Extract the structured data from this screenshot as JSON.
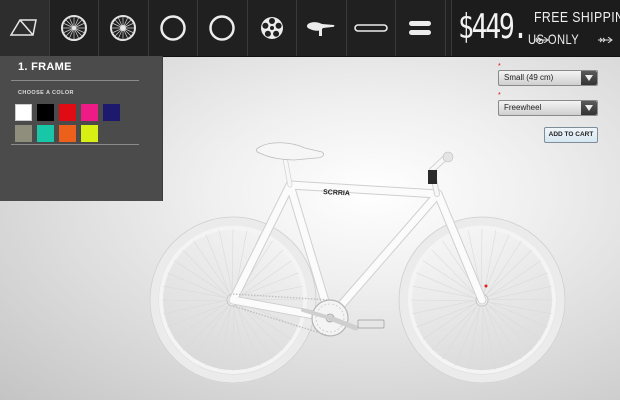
{
  "toolbar": {
    "tools": [
      {
        "name": "frame-icon"
      },
      {
        "name": "front-wheel-icon"
      },
      {
        "name": "rear-wheel-icon"
      },
      {
        "name": "front-tire-icon"
      },
      {
        "name": "rear-tire-icon"
      },
      {
        "name": "chainring-icon"
      },
      {
        "name": "saddle-icon"
      },
      {
        "name": "chain-icon"
      },
      {
        "name": "grips-icon"
      }
    ],
    "price": "$449.",
    "shipping_line1": "FREE SHIPPING",
    "shipping_line2": "US ONLY"
  },
  "panel": {
    "title": "1. FRAME",
    "choose_label": "CHOOSE A COLOR",
    "colors": [
      "#ffffff",
      "#000000",
      "#e10b14",
      "#ee1a86",
      "#1d1a6e",
      "#8f8d7c",
      "#18c6a8",
      "#ed601c",
      "#d8ef14"
    ]
  },
  "options": {
    "size": "Small (49 cm)",
    "drivetrain": "Freewheel",
    "required_mark": "*",
    "add_to_cart": "ADD TO CART"
  },
  "bike": {
    "brand_decal": "SCRRIA"
  }
}
